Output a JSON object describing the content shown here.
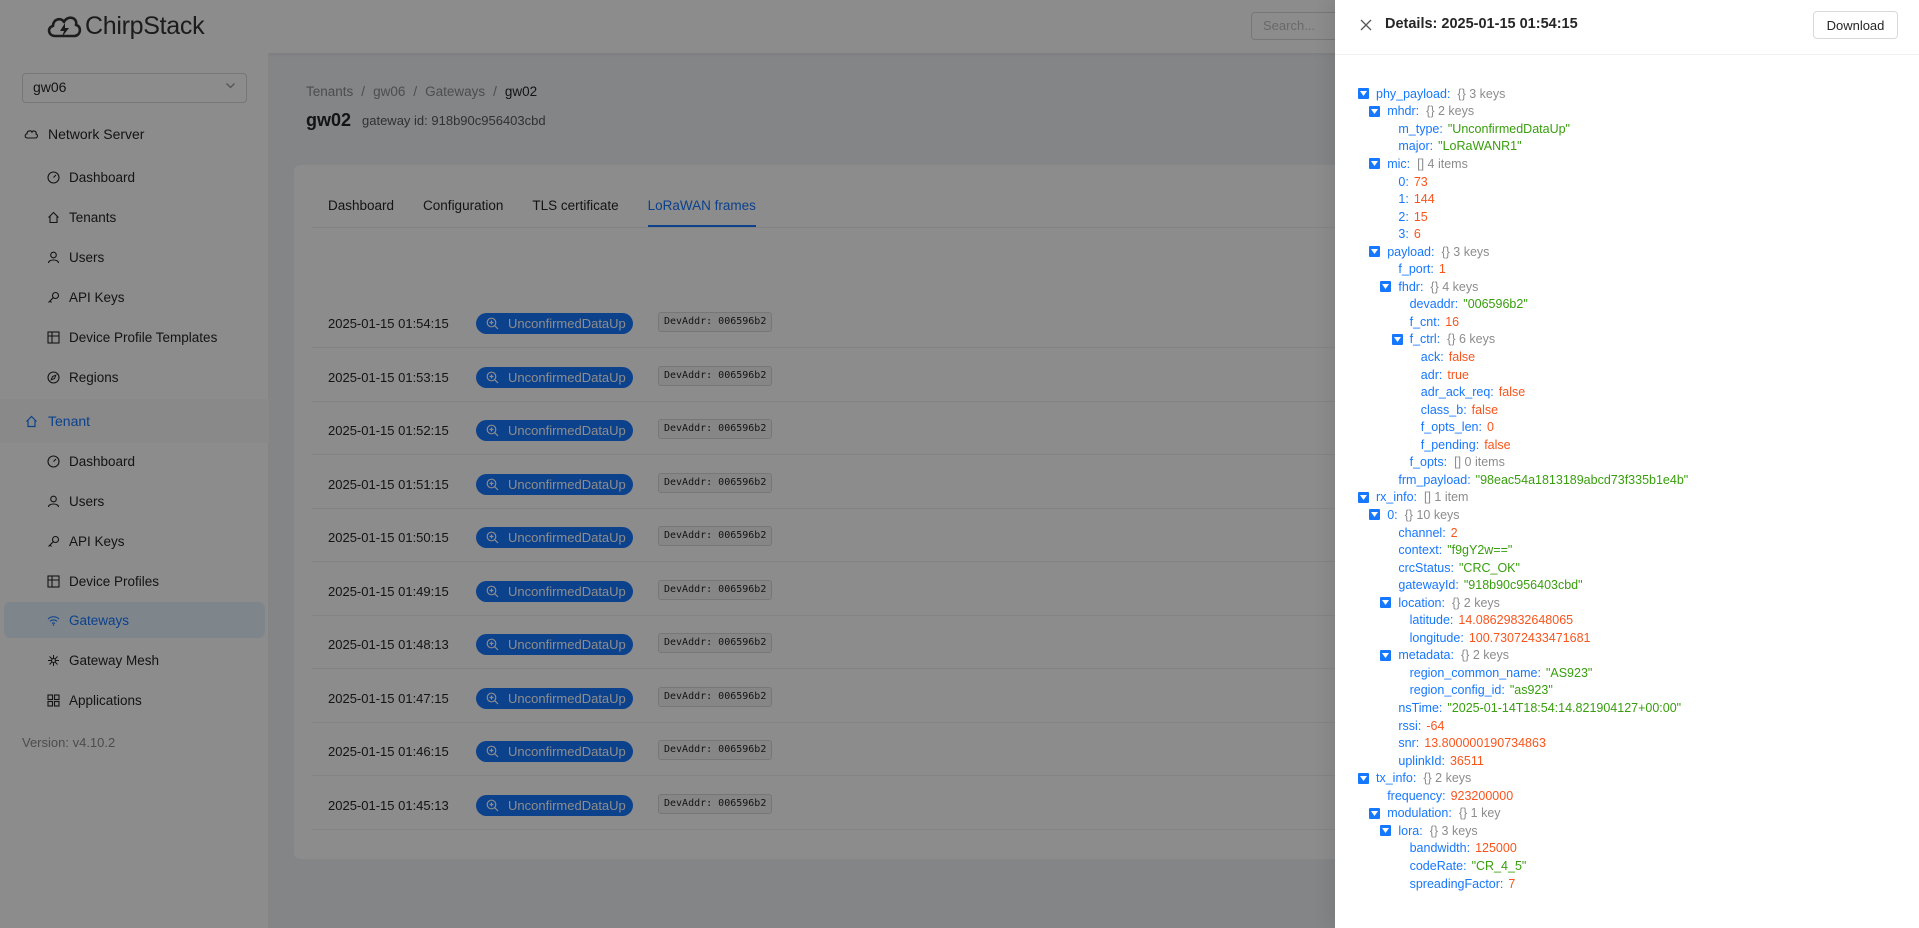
{
  "app": {
    "logo_text": "ChirpStack",
    "search_placeholder": "Search...",
    "tenant_select": "gw06",
    "version": "Version: v4.10.2"
  },
  "sidebar": {
    "network_server": "Network Server",
    "ns_items": [
      {
        "label": "Dashboard",
        "icon": "dashboard-icon"
      },
      {
        "label": "Tenants",
        "icon": "home-icon"
      },
      {
        "label": "Users",
        "icon": "user-icon"
      },
      {
        "label": "API Keys",
        "icon": "key-icon"
      },
      {
        "label": "Device Profile Templates",
        "icon": "table-icon"
      },
      {
        "label": "Regions",
        "icon": "compass-icon"
      }
    ],
    "tenant": "Tenant",
    "tenant_items": [
      {
        "label": "Dashboard",
        "icon": "dashboard-icon"
      },
      {
        "label": "Users",
        "icon": "user-icon"
      },
      {
        "label": "API Keys",
        "icon": "key-icon"
      },
      {
        "label": "Device Profiles",
        "icon": "table-icon"
      },
      {
        "label": "Gateways",
        "icon": "wifi-icon"
      },
      {
        "label": "Gateway Mesh",
        "icon": "mesh-icon"
      },
      {
        "label": "Applications",
        "icon": "appstore-icon"
      }
    ]
  },
  "breadcrumb": [
    "Tenants",
    "gw06",
    "Gateways",
    "gw02"
  ],
  "page": {
    "title": "gw02",
    "subtitle": "gateway id: 918b90c956403cbd"
  },
  "tabs": [
    "Dashboard",
    "Configuration",
    "TLS certificate",
    "LoRaWAN frames"
  ],
  "frames": [
    {
      "time": "2025-01-15 01:54:15",
      "type": "UnconfirmedDataUp",
      "addr": "DevAddr: 006596b2"
    },
    {
      "time": "2025-01-15 01:53:15",
      "type": "UnconfirmedDataUp",
      "addr": "DevAddr: 006596b2"
    },
    {
      "time": "2025-01-15 01:52:15",
      "type": "UnconfirmedDataUp",
      "addr": "DevAddr: 006596b2"
    },
    {
      "time": "2025-01-15 01:51:15",
      "type": "UnconfirmedDataUp",
      "addr": "DevAddr: 006596b2"
    },
    {
      "time": "2025-01-15 01:50:15",
      "type": "UnconfirmedDataUp",
      "addr": "DevAddr: 006596b2"
    },
    {
      "time": "2025-01-15 01:49:15",
      "type": "UnconfirmedDataUp",
      "addr": "DevAddr: 006596b2"
    },
    {
      "time": "2025-01-15 01:48:13",
      "type": "UnconfirmedDataUp",
      "addr": "DevAddr: 006596b2"
    },
    {
      "time": "2025-01-15 01:47:15",
      "type": "UnconfirmedDataUp",
      "addr": "DevAddr: 006596b2"
    },
    {
      "time": "2025-01-15 01:46:15",
      "type": "UnconfirmedDataUp",
      "addr": "DevAddr: 006596b2"
    },
    {
      "time": "2025-01-15 01:45:13",
      "type": "UnconfirmedDataUp",
      "addr": "DevAddr: 006596b2"
    }
  ],
  "drawer": {
    "title": "Details: 2025-01-15 01:54:15",
    "download_label": "Download",
    "tree": [
      {
        "d": 0,
        "k": "phy_payload",
        "m": "{}  3 keys",
        "t": 1
      },
      {
        "d": 1,
        "k": "mhdr",
        "m": "{}  2 keys",
        "t": 1
      },
      {
        "d": 2,
        "k": "m_type",
        "s": "\"UnconfirmedDataUp\""
      },
      {
        "d": 2,
        "k": "major",
        "s": "\"LoRaWANR1\""
      },
      {
        "d": 1,
        "k": "mic",
        "m": "[]  4 items",
        "t": 1
      },
      {
        "d": 2,
        "k": "0",
        "n": "73"
      },
      {
        "d": 2,
        "k": "1",
        "n": "144"
      },
      {
        "d": 2,
        "k": "2",
        "n": "15"
      },
      {
        "d": 2,
        "k": "3",
        "n": "6"
      },
      {
        "d": 1,
        "k": "payload",
        "m": "{}  3 keys",
        "t": 1
      },
      {
        "d": 2,
        "k": "f_port",
        "n": "1"
      },
      {
        "d": 2,
        "k": "fhdr",
        "m": "{}  4 keys",
        "t": 1
      },
      {
        "d": 3,
        "k": "devaddr",
        "s": "\"006596b2\""
      },
      {
        "d": 3,
        "k": "f_cnt",
        "n": "16"
      },
      {
        "d": 3,
        "k": "f_ctrl",
        "m": "{}  6 keys",
        "t": 1
      },
      {
        "d": 4,
        "k": "ack",
        "n": "false"
      },
      {
        "d": 4,
        "k": "adr",
        "n": "true"
      },
      {
        "d": 4,
        "k": "adr_ack_req",
        "n": "false"
      },
      {
        "d": 4,
        "k": "class_b",
        "n": "false"
      },
      {
        "d": 4,
        "k": "f_opts_len",
        "n": "0"
      },
      {
        "d": 4,
        "k": "f_pending",
        "n": "false"
      },
      {
        "d": 3,
        "k": "f_opts",
        "m": "[]  0 items"
      },
      {
        "d": 2,
        "k": "frm_payload",
        "s": "\"98eac54a1813189abcd73f335b1e4b\""
      },
      {
        "d": 0,
        "k": "rx_info",
        "m": "[]  1 item",
        "t": 1
      },
      {
        "d": 1,
        "k": "0",
        "m": "{}  10 keys",
        "t": 1
      },
      {
        "d": 2,
        "k": "channel",
        "n": "2"
      },
      {
        "d": 2,
        "k": "context",
        "s": "\"f9gY2w==\""
      },
      {
        "d": 2,
        "k": "crcStatus",
        "s": "\"CRC_OK\""
      },
      {
        "d": 2,
        "k": "gatewayId",
        "s": "\"918b90c956403cbd\""
      },
      {
        "d": 2,
        "k": "location",
        "m": "{}  2 keys",
        "t": 1
      },
      {
        "d": 3,
        "k": "latitude",
        "n": "14.08629832648065"
      },
      {
        "d": 3,
        "k": "longitude",
        "n": "100.73072433471681"
      },
      {
        "d": 2,
        "k": "metadata",
        "m": "{}  2 keys",
        "t": 1
      },
      {
        "d": 3,
        "k": "region_common_name",
        "s": "\"AS923\""
      },
      {
        "d": 3,
        "k": "region_config_id",
        "s": "\"as923\""
      },
      {
        "d": 2,
        "k": "nsTime",
        "s": "\"2025-01-14T18:54:14.821904127+00:00\""
      },
      {
        "d": 2,
        "k": "rssi",
        "n": "-64"
      },
      {
        "d": 2,
        "k": "snr",
        "n": "13.800000190734863"
      },
      {
        "d": 2,
        "k": "uplinkId",
        "n": "36511"
      },
      {
        "d": 0,
        "k": "tx_info",
        "m": "{}  2 keys",
        "t": 1
      },
      {
        "d": 1,
        "k": "frequency",
        "n": "923200000"
      },
      {
        "d": 1,
        "k": "modulation",
        "m": "{}  1 key",
        "t": 1
      },
      {
        "d": 2,
        "k": "lora",
        "m": "{}  3 keys",
        "t": 1
      },
      {
        "d": 3,
        "k": "bandwidth",
        "n": "125000"
      },
      {
        "d": 3,
        "k": "codeRate",
        "s": "\"CR_4_5\""
      },
      {
        "d": 3,
        "k": "spreadingFactor",
        "n": "7"
      }
    ]
  },
  "colors": {
    "primary": "#1677ff",
    "string_value": "#389e0d",
    "number_value": "#fa541c",
    "selected_bg": "#e6f4ff"
  }
}
